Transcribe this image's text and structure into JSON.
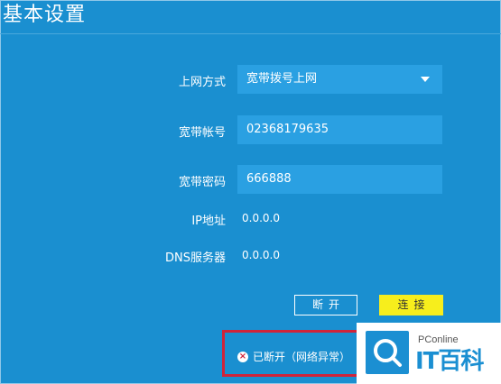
{
  "page": {
    "title": "基本设置"
  },
  "form": {
    "connection_type": {
      "label": "上网方式",
      "value": "宽带拨号上网"
    },
    "account": {
      "label": "宽带帐号",
      "value": "02368179635"
    },
    "password": {
      "label": "宽带密码",
      "value": "666888"
    },
    "ip": {
      "label": "IP地址",
      "value": "0.0.0.0"
    },
    "dns": {
      "label": "DNS服务器",
      "value": "0.0.0.0"
    }
  },
  "buttons": {
    "disconnect": "断开",
    "connect": "连接"
  },
  "status": {
    "icon": "error-x-icon",
    "text": "已断开（网络异常）",
    "highlight_color": "#d0243a"
  },
  "watermark": {
    "site": "PConline",
    "brand": "IT百科"
  },
  "colors": {
    "background": "#1a8fd0",
    "field": "#2aa0e2",
    "connect_button": "#f7ee1c"
  }
}
